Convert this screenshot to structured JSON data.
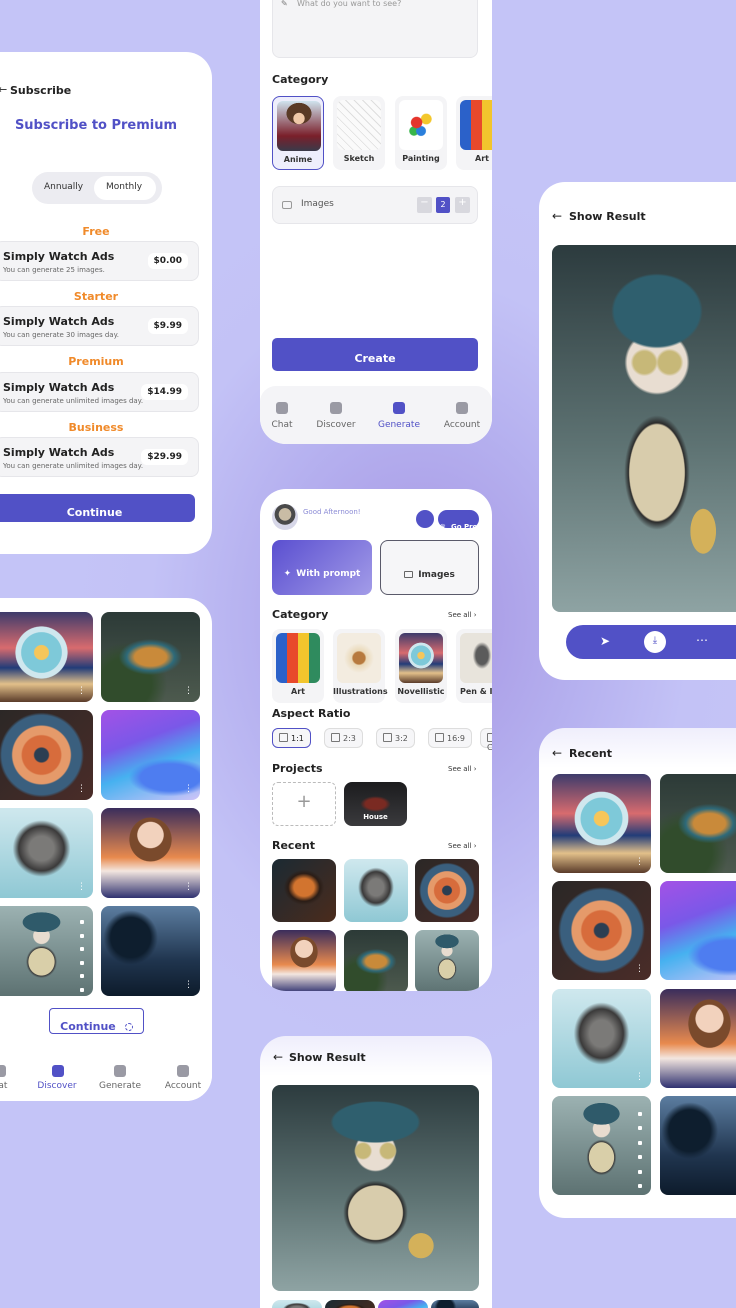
{
  "colors": {
    "accent": "#5151c6",
    "orange": "#f08a2a",
    "bg": "#c4c4f7"
  },
  "subscribe": {
    "back_label": "Subscribe",
    "title": "Subscribe to Premium",
    "toggle": [
      "Annually",
      "Monthly"
    ],
    "selected_toggle": "Monthly",
    "plans": [
      {
        "tier": "Free",
        "title": "Simply Watch Ads",
        "desc": "You can generate 25 images.",
        "price": "$0.00"
      },
      {
        "tier": "Starter",
        "title": "Simply Watch Ads",
        "desc": "You can generate 30 images day.",
        "price": "$9.99"
      },
      {
        "tier": "Premium",
        "title": "Simply Watch Ads",
        "desc": "You can generate unlimited images day.",
        "price": "$14.99"
      },
      {
        "tier": "Business",
        "title": "Simply Watch Ads",
        "desc": "You can generate unlimited images day.",
        "price": "$29.99"
      }
    ],
    "continue": "Continue"
  },
  "generate": {
    "prompt_placeholder": "What do you want to see?",
    "category_title": "Category",
    "categories": [
      "Anime",
      "Sketch",
      "Painting",
      "Art"
    ],
    "images_label": "Images",
    "images_count": "2",
    "create": "Create",
    "nav": [
      "Chat",
      "Discover",
      "Generate",
      "Account"
    ],
    "active_nav": "Generate"
  },
  "home": {
    "greeting": "Good Afternoon!",
    "gopro": "Go Pro",
    "with_prompt": "With prompt",
    "images": "Images",
    "category_title": "Category",
    "see_all": "See all",
    "categories": [
      "Art",
      "Illustrations",
      "Novellistic",
      "Pen & In"
    ],
    "aspect_title": "Aspect Ratio",
    "aspects": [
      "1:1",
      "2:3",
      "3:2",
      "16:9",
      "Co"
    ],
    "selected_aspect": "1:1",
    "projects_title": "Projects",
    "project_name": "House",
    "recent_title": "Recent"
  },
  "discover": {
    "continue": "Continue",
    "nav": [
      "hat",
      "Discover",
      "Generate",
      "Account"
    ],
    "active_nav": "Discover"
  },
  "result1": {
    "back_label": "Show Result"
  },
  "result2": {
    "back_label": "Show Result"
  },
  "recent": {
    "back_label": "Recent"
  }
}
